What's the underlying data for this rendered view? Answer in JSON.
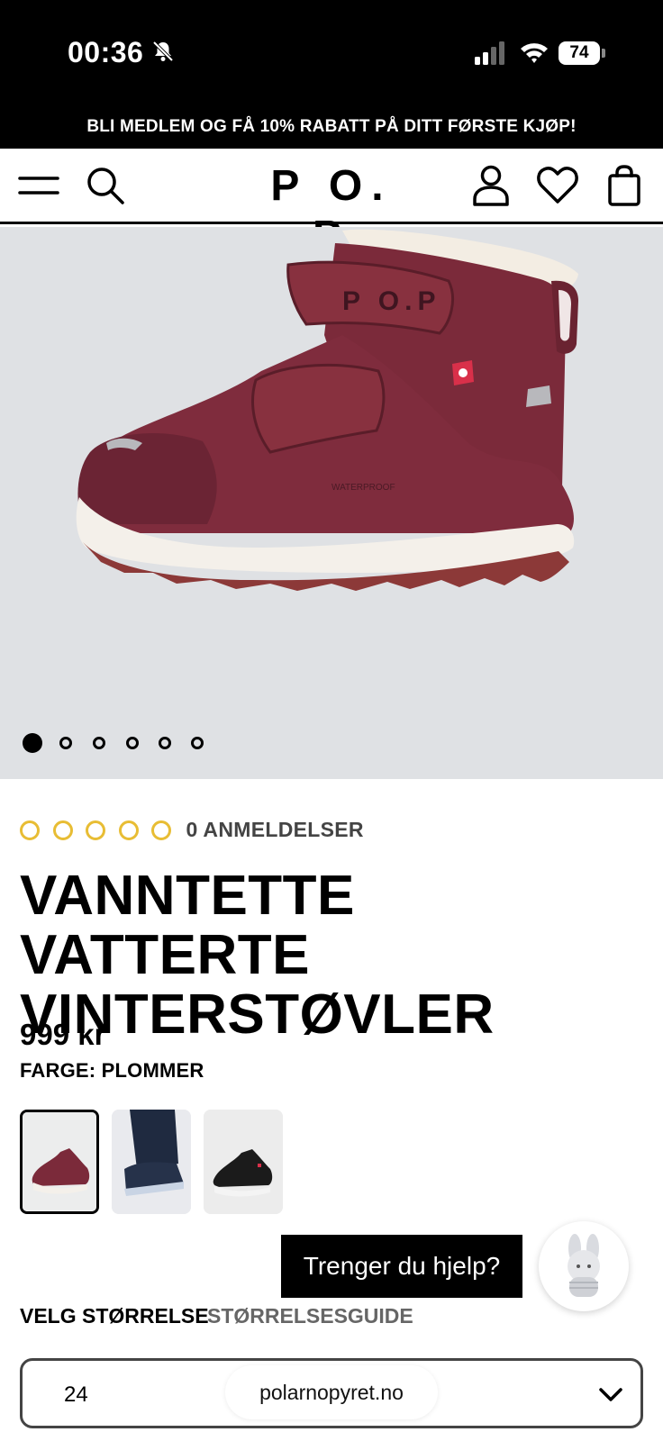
{
  "status_bar": {
    "time": "00:36",
    "battery": "74"
  },
  "promo_banner": {
    "text": "BLI MEDLEM OG FÅ 10% RABATT PÅ DITT FØRSTE KJØP!"
  },
  "header": {
    "logo": "P O. P",
    "icons": [
      "menu-icon",
      "search-icon",
      "account-icon",
      "heart-icon",
      "bag-icon"
    ]
  },
  "product": {
    "image_count": 6,
    "active_image": 1,
    "rating": 0,
    "review_count_label": "0 ANMELDELSER",
    "title": "VANNTETTE VATTERTE VINTERSTØVLER",
    "price": "999 kr",
    "color_label": "FARGE: PLOMMER",
    "boot_print": {
      "brand": "P O.P",
      "waterproof": "WATERPROOF"
    },
    "swatches": [
      {
        "name": "Plommer",
        "selected": true,
        "color": "#7b2a3a"
      },
      {
        "name": "Navy",
        "selected": false,
        "color": "#26324a"
      },
      {
        "name": "Black",
        "selected": false,
        "color": "#1b1b1b"
      }
    ]
  },
  "help": {
    "button_label": "Trenger du hjelp?"
  },
  "size": {
    "label": "VELG STØRRELSE",
    "guide_link": "STØRRELSESGUIDE",
    "selected": "24"
  },
  "browser": {
    "url": "polarnopyret.no"
  },
  "colors": {
    "accent_star": "#e8bd34",
    "boot": "#7b2a3a",
    "hero_bg": "#dfe1e4"
  }
}
